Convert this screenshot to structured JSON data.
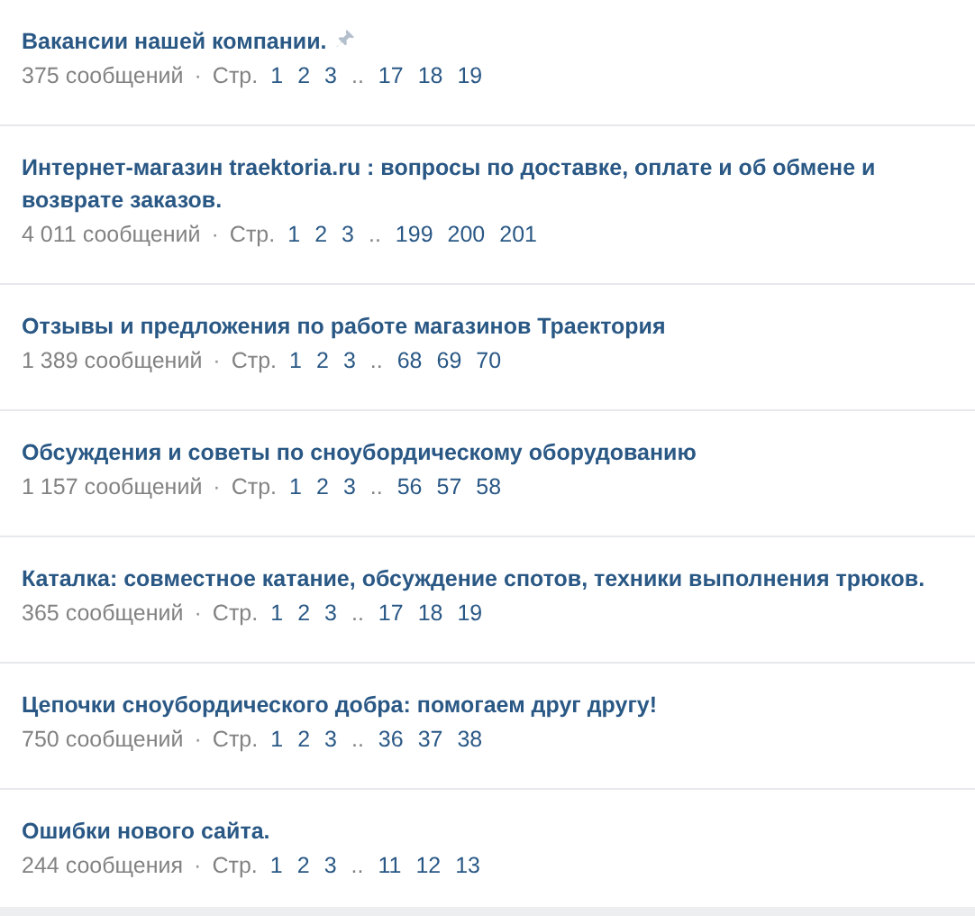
{
  "topics": [
    {
      "title": "Вакансии нашей компании.",
      "pinned": true,
      "count": "375 сообщений",
      "separator": "·",
      "pages_label": "Стр.",
      "pages": [
        "1",
        "2",
        "3",
        "..",
        "17",
        "18",
        "19"
      ]
    },
    {
      "title": "Интернет-магазин traektoria.ru : вопросы по доставке, оплате и об обмене и возврате заказов.",
      "pinned": false,
      "count": "4 011 сообщений",
      "separator": "·",
      "pages_label": "Стр.",
      "pages": [
        "1",
        "2",
        "3",
        "..",
        "199",
        "200",
        "201"
      ]
    },
    {
      "title": "Отзывы и предложения по работе магазинов Траектория",
      "pinned": false,
      "count": "1 389 сообщений",
      "separator": "·",
      "pages_label": "Стр.",
      "pages": [
        "1",
        "2",
        "3",
        "..",
        "68",
        "69",
        "70"
      ]
    },
    {
      "title": "Обсуждения и советы по сноубордическому оборудованию",
      "pinned": false,
      "count": "1 157 сообщений",
      "separator": "·",
      "pages_label": "Стр.",
      "pages": [
        "1",
        "2",
        "3",
        "..",
        "56",
        "57",
        "58"
      ]
    },
    {
      "title": "Каталка: совместное катание, обсуждение спотов, техники выполнения трюков.",
      "pinned": false,
      "count": "365 сообщений",
      "separator": "·",
      "pages_label": "Стр.",
      "pages": [
        "1",
        "2",
        "3",
        "..",
        "17",
        "18",
        "19"
      ]
    },
    {
      "title": "Цепочки сноубордического добра: помогаем друг другу!",
      "pinned": false,
      "count": "750 сообщений",
      "separator": "·",
      "pages_label": "Стр.",
      "pages": [
        "1",
        "2",
        "3",
        "..",
        "36",
        "37",
        "38"
      ]
    },
    {
      "title": "Ошибки нового сайта.",
      "pinned": false,
      "count": "244 сообщения",
      "separator": "·",
      "pages_label": "Стр.",
      "pages": [
        "1",
        "2",
        "3",
        "..",
        "11",
        "12",
        "13"
      ]
    }
  ]
}
